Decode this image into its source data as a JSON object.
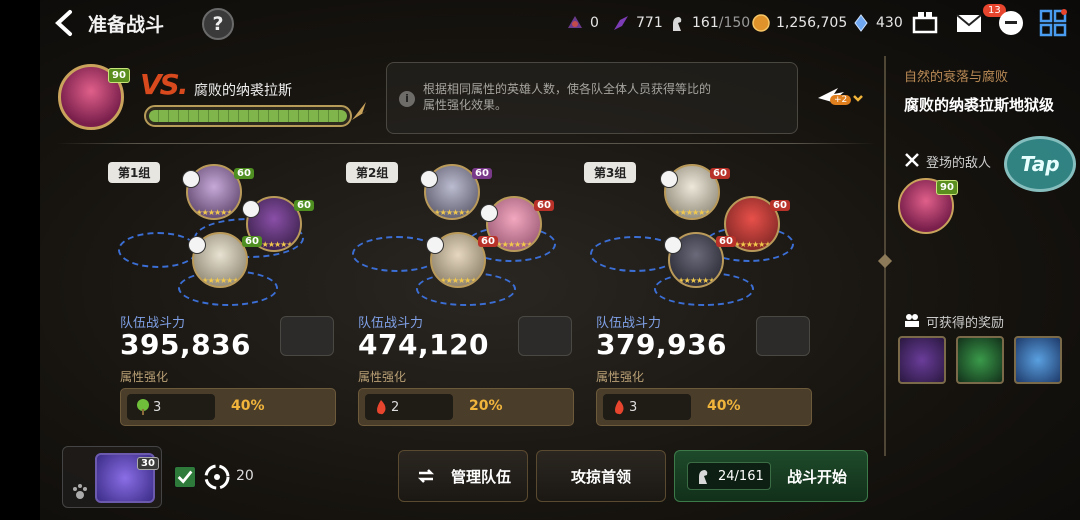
{
  "header": {
    "title": "准备战斗",
    "help_label": "?",
    "resources": {
      "energy_a": "0",
      "energy_b": "771",
      "stamina_current": "161",
      "stamina_max": "/150",
      "gold": "1,256,705",
      "crystal": "430"
    },
    "mail_badge": "13"
  },
  "boss": {
    "level": "90",
    "vs_label": "VS.",
    "name": "腐败的纳裘拉斯",
    "info_text": "根据相同属性的英雄人数，使各队全体人员获得等比的属性强化效果。",
    "buff_count": "+2"
  },
  "teams": [
    {
      "tag": "第1组",
      "power_label": "队伍战斗力",
      "power": "395,836",
      "attr_label": "属性强化",
      "attr_count": "3",
      "attr_pct": "40%",
      "heroes": [
        {
          "level": "60",
          "lv_color": "#4f8f22"
        },
        {
          "level": "60",
          "lv_color": "#4f8f22"
        },
        {
          "level": "60",
          "lv_color": "#4f8f22"
        }
      ]
    },
    {
      "tag": "第2组",
      "power_label": "队伍战斗力",
      "power": "474,120",
      "attr_label": "属性强化",
      "attr_count": "2",
      "attr_pct": "20%",
      "heroes": [
        {
          "level": "60",
          "lv_color": "#7a3a8a"
        },
        {
          "level": "60",
          "lv_color": "#b8322a"
        },
        {
          "level": "60",
          "lv_color": "#b8322a"
        }
      ]
    },
    {
      "tag": "第3组",
      "power_label": "队伍战斗力",
      "power": "379,936",
      "attr_label": "属性强化",
      "attr_count": "3",
      "attr_pct": "40%",
      "heroes": [
        {
          "level": "60",
          "lv_color": "#b8322a"
        },
        {
          "level": "60",
          "lv_color": "#b8322a"
        },
        {
          "level": "60",
          "lv_color": "#b8322a"
        }
      ]
    }
  ],
  "right_panel": {
    "subtitle": "自然的衰落与腐败",
    "title": "腐败的纳裘拉斯地狱级",
    "enemies_label": "登场的敌人",
    "enemy_level": "90",
    "tap_label": "Tap",
    "rewards_label": "可获得的奖励"
  },
  "bottom": {
    "pet_level": "30",
    "auto_count": "20",
    "manage_label": "管理队伍",
    "strategy_label": "攻掠首领",
    "stamina_cost": "24/161",
    "start_label": "战斗开始"
  },
  "colors": {
    "accent_gold": "#f1b53c",
    "power_blue": "#7fa0e6",
    "start_green": "#1e4a2a"
  }
}
